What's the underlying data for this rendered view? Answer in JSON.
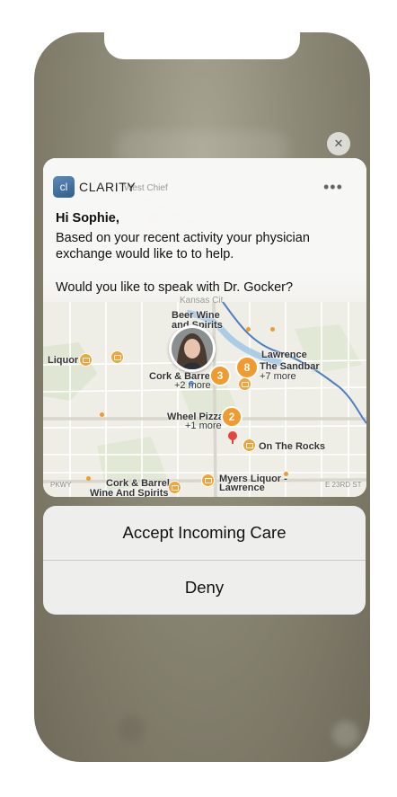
{
  "notification": {
    "app_name": "CLARITY",
    "app_icon_text": "cl",
    "greeting": "Hi Sophie,",
    "body_line1": "Based on your recent activity your physician",
    "body_line2": "exchange would like to to help.",
    "question": "Would you like to speak with Dr. Gocker?",
    "more_glyph": "•••",
    "close_glyph": "✕"
  },
  "map": {
    "labels": {
      "beer_wine": "Beer Wine",
      "and_spirits": "and Spirits",
      "liquor": "Liquor",
      "cork_barrel": "Cork & Barrel",
      "cork_more": "+2 more",
      "cork_count": "3",
      "sandbar_count": "8",
      "sandbar": "The Sandbar",
      "sandbar_more": "+7 more",
      "lawrence": "Lawrence",
      "wheel_pizza": "Wheel Pizza",
      "wheel_more": "+1 more",
      "wheel_count": "2",
      "on_the_rocks": "On The Rocks",
      "cork_barrel_2": "Cork & Barrel",
      "wine_spirits": "Wine And Spirits",
      "myers": "Myers Liquor -",
      "myers_2": "Lawrence",
      "pkwy": "PKWY",
      "e23rd": "E 23RD ST",
      "west_chief": "West Chief",
      "kansas": "Kansas Cit"
    }
  },
  "actions": {
    "accept": "Accept Incoming Care",
    "deny": "Deny"
  },
  "colors": {
    "accent_orange": "#f09a2f",
    "river_blue": "#4a7fc1",
    "app_icon_blue": "#2f5f8c"
  }
}
